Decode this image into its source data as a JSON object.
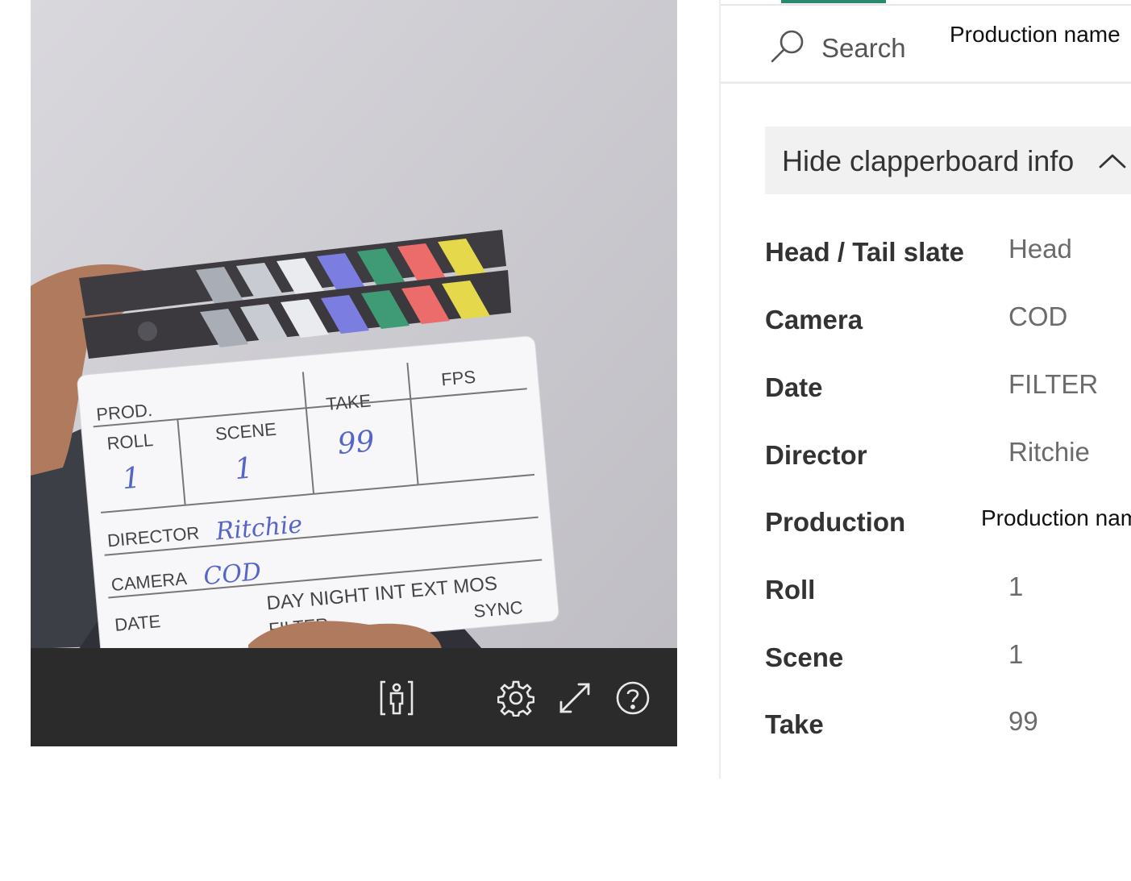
{
  "video": {
    "controls": [
      {
        "name": "person-frame-icon"
      },
      {
        "name": "gear-icon"
      },
      {
        "name": "expand-icon"
      },
      {
        "name": "help-icon"
      }
    ],
    "slate": {
      "prod": "PROD.",
      "roll": "ROLL",
      "scene": "SCENE",
      "take": "TAKE",
      "fps": "FPS",
      "roll_value": "1",
      "scene_value": "1",
      "take_value": "99",
      "director": "DIRECTOR",
      "director_value": "Ritchie",
      "camera": "CAMERA",
      "camera_value": "COD",
      "date": "DATE",
      "day_night": "DAY NIGHT INT EXT MOS",
      "filter": "FILTER",
      "sync": "SYNC"
    }
  },
  "panel": {
    "search_placeholder": "Search",
    "production_name_top": "Production name",
    "toggle_label": "Hide clapperboard info",
    "rows": [
      {
        "label": "Head / Tail slate",
        "value": "Head"
      },
      {
        "label": "Camera",
        "value": "COD"
      },
      {
        "label": "Date",
        "value": "FILTER"
      },
      {
        "label": "Director",
        "value": "Ritchie"
      },
      {
        "label": "Production",
        "value": "Production name"
      },
      {
        "label": "Roll",
        "value": "1"
      },
      {
        "label": "Scene",
        "value": "1"
      },
      {
        "label": "Take",
        "value": "99"
      }
    ]
  },
  "colors": {
    "accent": "#2a8a6e",
    "control_bar": "#2b2b2b",
    "toggle_bg": "#f1f1f1"
  }
}
